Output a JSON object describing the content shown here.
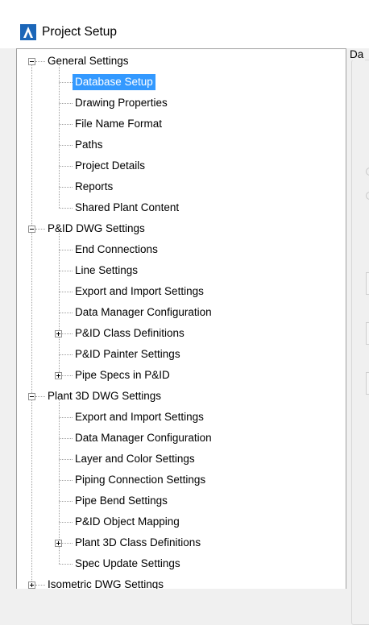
{
  "window": {
    "title": "Project Setup"
  },
  "right_panel": {
    "group_label": "Da"
  },
  "tree": [
    {
      "label": "General Settings",
      "level": 0,
      "expander": "minus"
    },
    {
      "label": "Database Setup",
      "level": 1,
      "selected": true
    },
    {
      "label": "Drawing Properties",
      "level": 1
    },
    {
      "label": "File Name Format",
      "level": 1
    },
    {
      "label": "Paths",
      "level": 1
    },
    {
      "label": "Project Details",
      "level": 1
    },
    {
      "label": "Reports",
      "level": 1
    },
    {
      "label": "Shared Plant Content",
      "level": 1
    },
    {
      "label": "P&ID DWG Settings",
      "level": 0,
      "expander": "minus"
    },
    {
      "label": "End Connections",
      "level": 1
    },
    {
      "label": "Line Settings",
      "level": 1
    },
    {
      "label": "Export and Import Settings",
      "level": 1
    },
    {
      "label": "Data Manager Configuration",
      "level": 1
    },
    {
      "label": "P&ID Class Definitions",
      "level": 1,
      "expander": "plus"
    },
    {
      "label": "P&ID Painter Settings",
      "level": 1
    },
    {
      "label": "Pipe Specs in P&ID",
      "level": 1,
      "expander": "plus"
    },
    {
      "label": "Plant 3D DWG Settings",
      "level": 0,
      "expander": "minus"
    },
    {
      "label": "Export and Import Settings",
      "level": 1
    },
    {
      "label": "Data Manager Configuration",
      "level": 1
    },
    {
      "label": "Layer and Color Settings",
      "level": 1
    },
    {
      "label": "Piping Connection Settings",
      "level": 1
    },
    {
      "label": "Pipe Bend Settings",
      "level": 1
    },
    {
      "label": "P&ID Object Mapping",
      "level": 1
    },
    {
      "label": "Plant 3D Class Definitions",
      "level": 1,
      "expander": "plus"
    },
    {
      "label": "Spec Update Settings",
      "level": 1
    },
    {
      "label": "Isometric DWG Settings",
      "level": 0,
      "expander": "plus"
    }
  ]
}
